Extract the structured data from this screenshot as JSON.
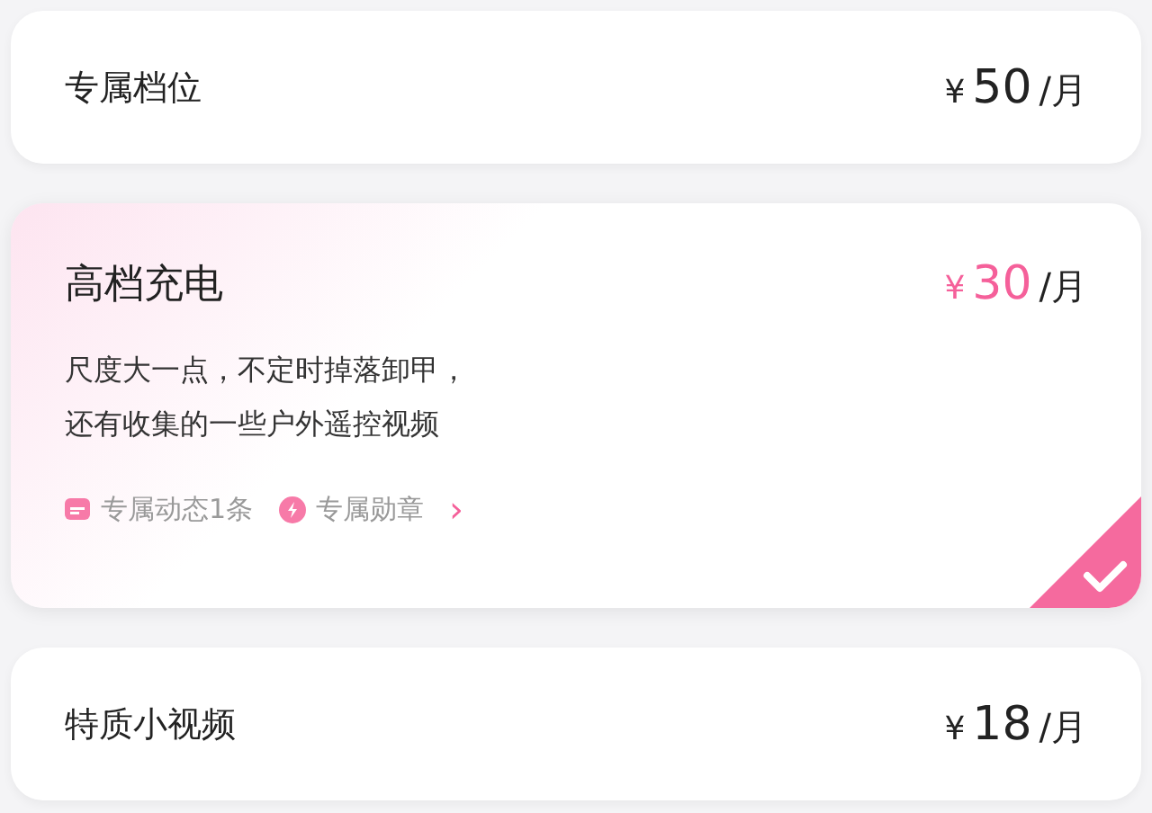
{
  "plans": [
    {
      "name": "专属档位",
      "currency": "¥",
      "price": "50",
      "unit": "/月",
      "selected": false
    },
    {
      "name": "高档充电",
      "currency": "¥",
      "price": "30",
      "unit": "/月",
      "selected": true,
      "description": [
        "尺度大一点，不定时掉落卸甲，",
        "还有收集的一些户外遥控视频"
      ],
      "perks": [
        {
          "kind": "post",
          "label": "专属动态1条"
        },
        {
          "kind": "badge",
          "label": "专属勋章"
        }
      ],
      "more": "›"
    },
    {
      "name": "特质小视频",
      "currency": "¥",
      "price": "18",
      "unit": "/月",
      "selected": false
    }
  ]
}
